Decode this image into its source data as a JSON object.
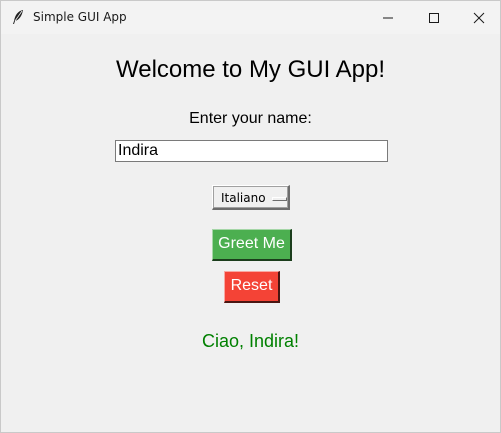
{
  "window": {
    "title": "Simple GUI App",
    "app_icon": "feather-icon",
    "controls": {
      "minimize_icon": "minimize-icon",
      "maximize_icon": "maximize-icon",
      "close_icon": "close-icon"
    }
  },
  "main": {
    "heading": "Welcome to My GUI App!",
    "name_prompt": "Enter your name:",
    "name_value": "Indira",
    "language": {
      "selected": "Italiano"
    },
    "greet_button_label": "Greet Me",
    "reset_button_label": "Reset",
    "greeting_text": "Ciao, Indira!"
  },
  "colors": {
    "window_background": "#f0f0f0",
    "greet_button": "#4caf50",
    "reset_button": "#f44336",
    "greeting_text": "#008000"
  }
}
